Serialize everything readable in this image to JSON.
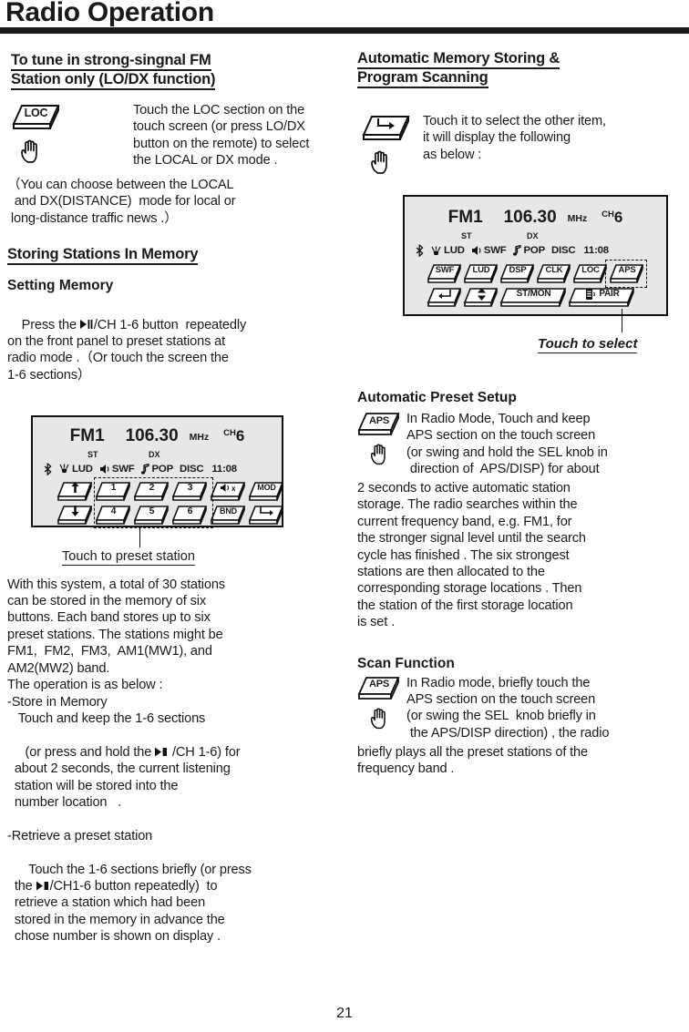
{
  "header": {
    "title": "Radio Operation"
  },
  "page_number": "21",
  "left_column": {
    "section1": {
      "heading_line1": "To tune in strong-singnal FM",
      "heading_line2": "Station only (LO/DX function)",
      "key_label": "LOC",
      "key_icon": "loc-button-icon",
      "hand_icon": "pointing-hand-icon",
      "paragraph": "Touch the LOC section on the\ntouch screen (or press LO/DX\nbutton on the remote) to select\nthe LOCAL or DX mode .",
      "note": "（You can choose between the LOCAL\n  and DX(DISTANCE)  mode for local or\n long-distance traffic news .）"
    },
    "section2": {
      "heading": "Storing Stations In Memory",
      "subheading": "Setting Memory",
      "paragraph_pre": "Press the ",
      "paragraph_post": "/CH 1-6 button  repeatedly\non the front panel to preset stations at\nradio mode .（Or touch the screen the\n1-6 sections）",
      "playpause_icon": "play-pause-icon",
      "caption": "Touch to preset station"
    },
    "display1": {
      "band": "FM1",
      "frequency": "106.30",
      "unit": "MHz",
      "ch_label": "CH",
      "ch_number": "6",
      "stereo": "ST",
      "dx": "DX",
      "indicators": [
        {
          "icon": "bluetooth-icon",
          "label": ""
        },
        {
          "icon": "loudness-icon",
          "label": "LUD"
        },
        {
          "icon": "speaker-icon",
          "label": "SWF"
        },
        {
          "icon": "music-note-icon",
          "label": "POP"
        },
        {
          "icon": "",
          "label": "DISC"
        },
        {
          "icon": "",
          "label": "11:08"
        }
      ],
      "keys_row1": [
        {
          "label": "",
          "icon": "arrow-up-icon"
        },
        {
          "label": "1",
          "icon": ""
        },
        {
          "label": "2",
          "icon": ""
        },
        {
          "label": "3",
          "icon": ""
        },
        {
          "label": "",
          "icon": "mute-icon"
        },
        {
          "label": "MOD",
          "icon": ""
        }
      ],
      "keys_row2": [
        {
          "label": "",
          "icon": "arrow-down-icon"
        },
        {
          "label": "4",
          "icon": ""
        },
        {
          "label": "5",
          "icon": ""
        },
        {
          "label": "6",
          "icon": ""
        },
        {
          "label": "BND",
          "icon": ""
        },
        {
          "label": "",
          "icon": "next-page-icon"
        }
      ]
    },
    "section3": {
      "paragraph": "With this system, a total of 30 stations\ncan be stored in the memory of six\nbuttons. Each band stores up to six\npreset stations. The stations might be\nFM1,  FM2,  FM3,  AM1(MW1), and\nAM2(MW2) band.\nThe operation is as below :\n-Store in Memory\n   Touch and keep the 1-6 sections",
      "store_line_pre": " (or press and hold the ",
      "store_line_post": " /CH 1-6) for\n  about 2 seconds, the current listening\n  station will be stored into the\n  number location   .",
      "retrieve_heading": "-Retrieve a preset station",
      "retrieve_pre": "  Touch the 1-6 sections briefly (or press\n  the ",
      "retrieve_post": "/CH1-6 button repeatedly)  to\n  retrieve a station which had been\n  stored in the memory in advance the\n  chose number is shown on display ."
    }
  },
  "right_column": {
    "section1": {
      "heading_line1": "Automatic Memory Storing &",
      "heading_line2": "Program Scanning",
      "key_icon": "next-page-icon",
      "hand_icon": "pointing-hand-icon",
      "paragraph": "Touch it to select the other item,\nit will display the following\nas below :",
      "caption": "Touch to select"
    },
    "display2": {
      "band": "FM1",
      "frequency": "106.30",
      "unit": "MHz",
      "ch_label": "CH",
      "ch_number": "6",
      "stereo": "ST",
      "dx": "DX",
      "indicators": [
        {
          "icon": "bluetooth-icon",
          "label": ""
        },
        {
          "icon": "loudness-icon",
          "label": "LUD"
        },
        {
          "icon": "speaker-icon",
          "label": "SWF"
        },
        {
          "icon": "music-note-icon",
          "label": "POP"
        },
        {
          "icon": "",
          "label": "DISC"
        },
        {
          "icon": "",
          "label": "11:08"
        }
      ],
      "keys_row1": [
        {
          "label": "SWF",
          "icon": ""
        },
        {
          "label": "LUD",
          "icon": ""
        },
        {
          "label": "DSP",
          "icon": ""
        },
        {
          "label": "CLK",
          "icon": ""
        },
        {
          "label": "LOC",
          "icon": ""
        },
        {
          "label": "APS",
          "icon": ""
        }
      ],
      "keys_row2": [
        {
          "label": "",
          "icon": "enter-return-icon"
        },
        {
          "label": "",
          "icon": "up-down-arrow-icon"
        },
        {
          "label": "ST/MON",
          "icon": ""
        },
        {
          "label": "PAIR",
          "icon": "phone-pair-icon"
        }
      ]
    },
    "section2": {
      "heading": "Automatic Preset Setup",
      "key_label": "APS",
      "key_icon": "aps-button-icon",
      "hand_icon": "pointing-hand-icon",
      "indent_paragraph": "In Radio Mode, Touch and keep\nAPS section on the touch screen\n(or swing and hold the SEL knob in\n direction of  APS/DISP) for about",
      "paragraph": "2 seconds to active automatic station\nstorage. The radio searches within the\ncurrent frequency band, e.g. FM1, for\nthe stronger signal level until the search\ncycle has finished . The six strongest\nstations are then allocated to the\ncorresponding storage locations . Then\nthe station of the first storage location\nis set ."
    },
    "section3": {
      "heading": "Scan Function",
      "key_label": "APS",
      "key_icon": "aps-button-icon",
      "hand_icon": "pointing-hand-icon",
      "indent_paragraph": "In Radio mode, briefly touch the\nAPS section on the touch screen\n(or swing the SEL  knob briefly in\n the APS/DISP direction) , the radio",
      "paragraph": "briefly plays all the preset stations of the\nfrequency band ."
    }
  }
}
